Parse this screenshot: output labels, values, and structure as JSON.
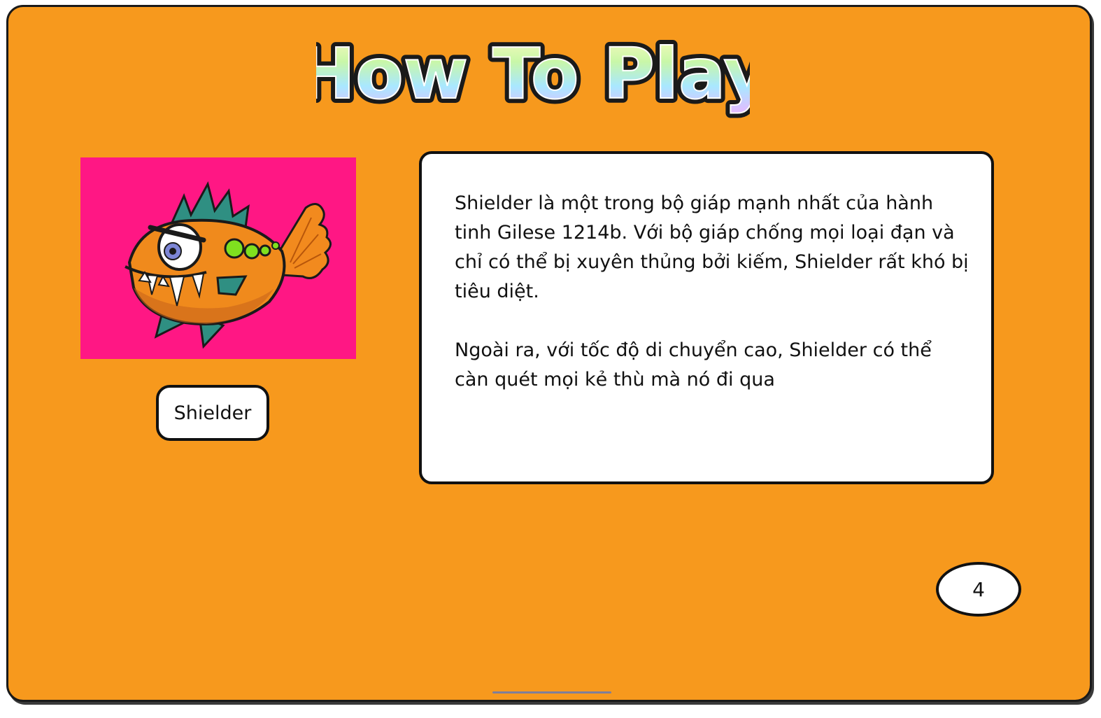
{
  "title": "How To Play",
  "character": {
    "name": "Shielder",
    "portrait_icon": "angry-orange-fish",
    "portrait_bg": "#ff1784"
  },
  "description": {
    "paragraph1": "Shielder là một trong bộ giáp mạnh nhất của hành tinh Gilese 1214b. Với bộ giáp chống mọi loại đạn và chỉ có thể bị xuyên thủng bởi kiếm, Shielder rất khó bị tiêu diệt.",
    "paragraph2": "Ngoài ra, với tốc độ di chuyển cao, Shielder có thể càn quét mọi kẻ thù mà nó đi qua"
  },
  "page_number": "4",
  "colors": {
    "background": "#f7991d",
    "panel_border": "#1a1a1a",
    "card": "#ffffff"
  }
}
